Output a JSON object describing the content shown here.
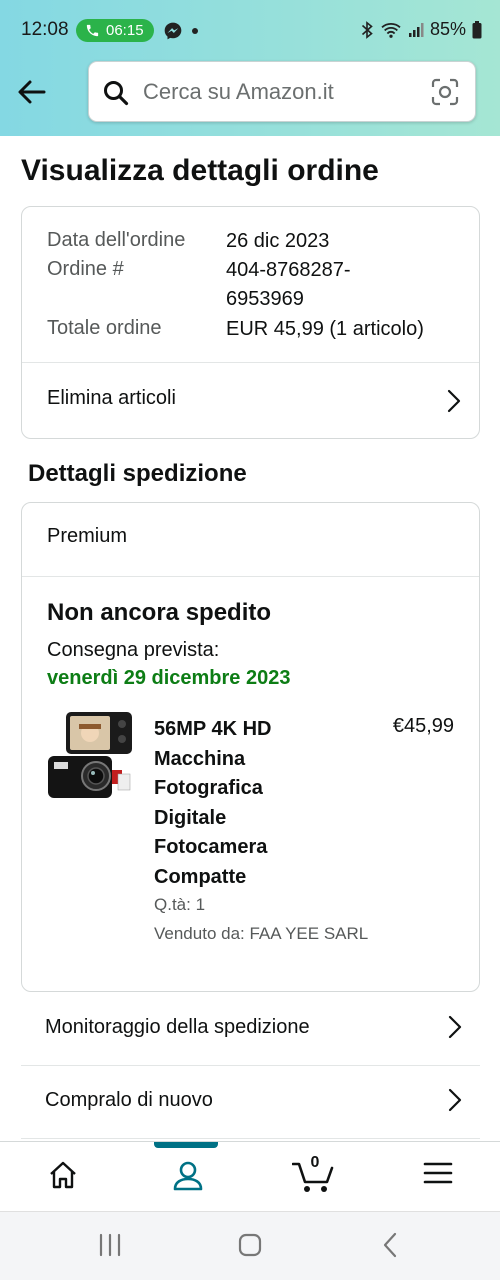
{
  "status_bar": {
    "time": "12:08",
    "call_timer": "06:15",
    "battery": "85%"
  },
  "header": {
    "search_placeholder": "Cerca su Amazon.it"
  },
  "page": {
    "title": "Visualizza dettagli ordine"
  },
  "order": {
    "date_label": "Data dell'ordine",
    "date_value": "26 dic 2023",
    "number_label": "Ordine #",
    "number_value_line1": "404-8768287-",
    "number_value_line2": "6953969",
    "total_label": "Totale ordine",
    "total_value": "EUR 45,99 (1 articolo)",
    "delete_items": "Elimina articoli"
  },
  "shipping": {
    "section_title": "Dettagli spedizione",
    "service": "Premium",
    "status": "Non ancora spedito",
    "expected_label": "Consegna prevista:",
    "expected_date": "venerdì 29 dicembre 2023",
    "product": {
      "name_lines": [
        "56MP 4K HD",
        "Macchina",
        "Fotografica",
        "Digitale",
        "Fotocamera",
        "Compatte"
      ],
      "price": "€45,99",
      "quantity": "Q.tà: 1",
      "seller": "Venduto da: FAA YEE SARL"
    }
  },
  "actions": {
    "track": "Monitoraggio della spedizione",
    "buy_again": "Compralo di nuovo"
  },
  "bottom_nav": {
    "cart_count": "0"
  },
  "colors": {
    "accent": "#007185",
    "delivery_green": "#0d7d15",
    "header_start": "#84d8e3",
    "header_end": "#a5e6d4"
  }
}
